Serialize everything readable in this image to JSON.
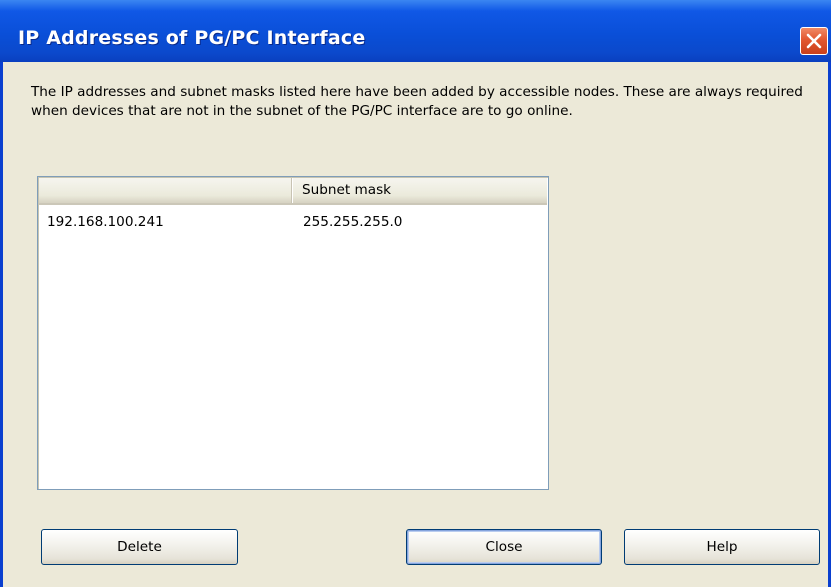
{
  "window": {
    "title": "IP Addresses of PG/PC Interface"
  },
  "description": "The IP addresses and subnet masks listed here have been added by accessible nodes. These are always required when devices that are not in the subnet of the PG/PC interface are to go online.",
  "table": {
    "columns": [
      "",
      "Subnet mask"
    ],
    "rows": [
      [
        "192.168.100.241",
        "255.255.255.0"
      ]
    ]
  },
  "buttons": {
    "delete": "Delete",
    "close": "Close",
    "help": "Help"
  },
  "colors": {
    "titlebar": "#0a4fd8",
    "close_button": "#e2572f",
    "dialog_background": "#ece9d8"
  },
  "icons": {
    "close": "close-icon"
  }
}
